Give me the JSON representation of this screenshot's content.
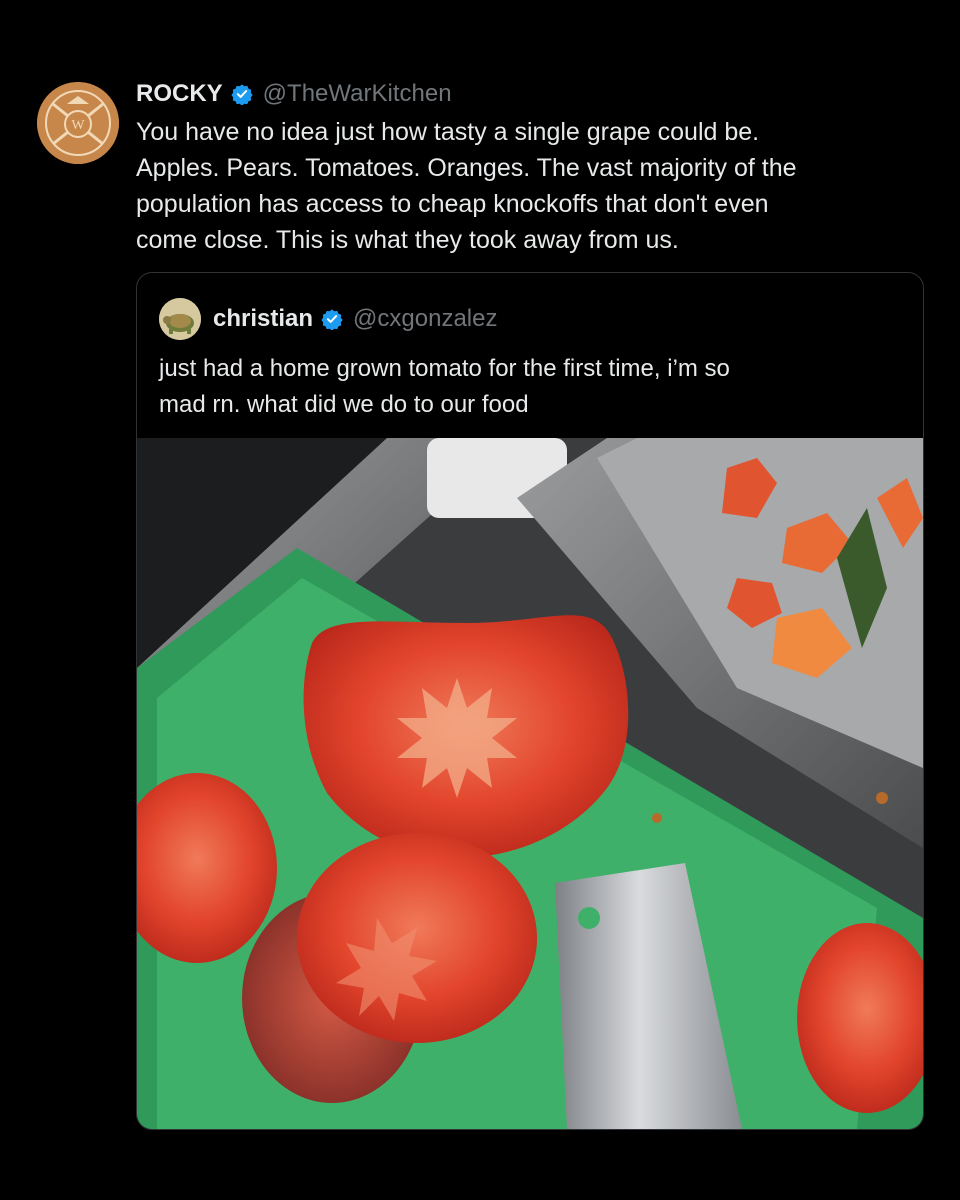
{
  "tweet": {
    "author_name": "ROCKY",
    "author_handle": "@TheWarKitchen",
    "verified": true,
    "text_lines": [
      "You have no idea just how tasty a single grape could be.",
      "Apples. Pears. Tomatoes. Oranges. The vast majority of the",
      "population has access to cheap knockoffs that don't even",
      "come close. This is what they took away from us."
    ]
  },
  "quoted_tweet": {
    "author_name": "christian",
    "author_handle": "@cxgonzalez",
    "verified": true,
    "text_lines": [
      "just had a home grown tomato for the first time, i’m so",
      "mad rn. what did we do to our food"
    ]
  },
  "colors": {
    "background": "#000000",
    "text_primary": "#e7e9ea",
    "text_secondary": "#71767b",
    "verified_blue": "#1d9bf0",
    "border": "#2f3336"
  },
  "icons": {
    "author_avatar": "war-kitchen-logo-icon",
    "quoted_avatar": "turtle-avatar-icon",
    "verified_badge": "verified-badge-icon"
  }
}
